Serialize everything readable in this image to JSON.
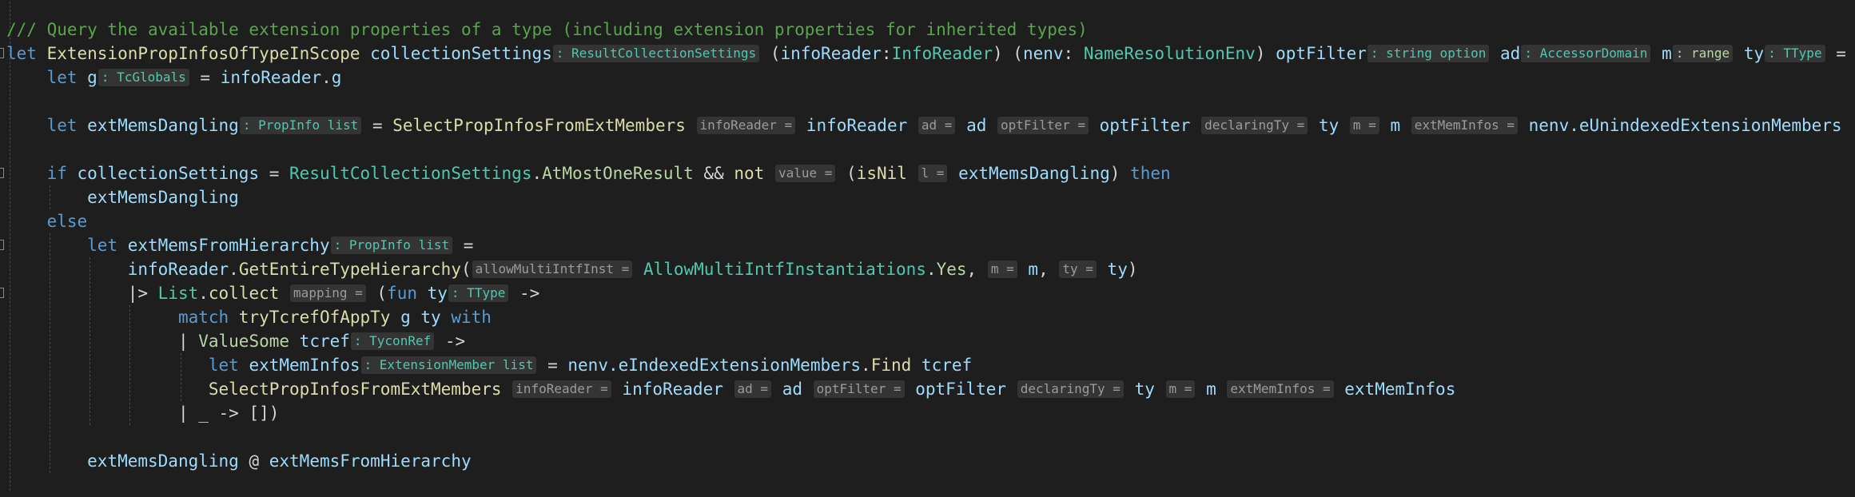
{
  "colors": {
    "background": "#1e1e1e",
    "keyword": "#569cd6",
    "function": "#dcdcaa",
    "variable": "#9cdcfe",
    "type": "#4ec9b0",
    "comment": "#57a64a",
    "union_case": "#b8d7a3",
    "hint_background": "#343434"
  },
  "code": {
    "lines": [
      {
        "tokens": []
      },
      {
        "tokens": [
          [
            "/// Query the available extension properties of a type (including extension properties for inherited types)",
            "com"
          ]
        ]
      },
      {
        "fold": true,
        "tokens": [
          [
            "let ",
            "kw"
          ],
          [
            "ExtensionPropInfosOfTypeInScope ",
            "fn"
          ],
          [
            "collectionSettings",
            "var"
          ],
          [
            ": ResultCollectionSettings",
            "ht"
          ],
          [
            " (",
            "p"
          ],
          [
            "infoReader",
            "var"
          ],
          [
            ":",
            "p"
          ],
          [
            "InfoReader",
            "type"
          ],
          [
            ") (",
            "p"
          ],
          [
            "nenv",
            "var"
          ],
          [
            ": ",
            "p"
          ],
          [
            "NameResolutionEnv",
            "type"
          ],
          [
            ") ",
            "p"
          ],
          [
            "optFilter",
            "var"
          ],
          [
            ": string option",
            "ht"
          ],
          [
            " ",
            "p"
          ],
          [
            "ad",
            "var"
          ],
          [
            ": AccessorDomain",
            "ht"
          ],
          [
            " ",
            "p"
          ],
          [
            "m",
            "var"
          ],
          [
            ": range",
            "hu"
          ],
          [
            " ",
            "p"
          ],
          [
            "ty",
            "var"
          ],
          [
            ": TType",
            "ht"
          ],
          [
            " =",
            "op"
          ]
        ]
      },
      {
        "tokens": [
          [
            "    ",
            "p"
          ],
          [
            "let ",
            "kw"
          ],
          [
            "g",
            "var"
          ],
          [
            ": TcGlobals",
            "ht"
          ],
          [
            " = ",
            "op"
          ],
          [
            "infoReader",
            "var"
          ],
          [
            ".g",
            "var"
          ]
        ]
      },
      {
        "tokens": []
      },
      {
        "tokens": [
          [
            "    ",
            "p"
          ],
          [
            "let ",
            "kw"
          ],
          [
            "extMemsDangling",
            "var"
          ],
          [
            ": PropInfo list",
            "ht"
          ],
          [
            " = ",
            "op"
          ],
          [
            "SelectPropInfosFromExtMembers ",
            "fn"
          ],
          [
            "infoReader =",
            "hp"
          ],
          [
            " ",
            "p"
          ],
          [
            "infoReader ",
            "var"
          ],
          [
            "ad =",
            "hp"
          ],
          [
            " ",
            "p"
          ],
          [
            "ad ",
            "var"
          ],
          [
            "optFilter =",
            "hp"
          ],
          [
            " ",
            "p"
          ],
          [
            "optFilter ",
            "var"
          ],
          [
            "declaringTy =",
            "hp"
          ],
          [
            " ",
            "p"
          ],
          [
            "ty ",
            "var"
          ],
          [
            "m =",
            "hp"
          ],
          [
            " ",
            "p"
          ],
          [
            "m ",
            "var"
          ],
          [
            "extMemInfos =",
            "hp"
          ],
          [
            " ",
            "p"
          ],
          [
            "nenv.eUnindexedExtensionMembers",
            "var"
          ]
        ]
      },
      {
        "tokens": []
      },
      {
        "fold": true,
        "tokens": [
          [
            "    ",
            "p"
          ],
          [
            "if ",
            "kw"
          ],
          [
            "collectionSettings ",
            "var"
          ],
          [
            "= ",
            "op"
          ],
          [
            "ResultCollectionSettings",
            "type"
          ],
          [
            ".",
            "op"
          ],
          [
            "AtMostOneResult ",
            "uc"
          ],
          [
            "&& ",
            "op"
          ],
          [
            "not ",
            "fn"
          ],
          [
            "value =",
            "hp"
          ],
          [
            " (",
            "p"
          ],
          [
            "isNil ",
            "fn"
          ],
          [
            "l =",
            "hp"
          ],
          [
            " ",
            "p"
          ],
          [
            "extMemsDangling",
            "var"
          ],
          [
            ") ",
            "p"
          ],
          [
            "then",
            "kw"
          ]
        ]
      },
      {
        "tokens": [
          [
            "        ",
            "p"
          ],
          [
            "extMemsDangling",
            "var"
          ]
        ]
      },
      {
        "tokens": [
          [
            "    ",
            "p"
          ],
          [
            "else",
            "kw"
          ]
        ]
      },
      {
        "fold": true,
        "tokens": [
          [
            "        ",
            "p"
          ],
          [
            "let ",
            "kw"
          ],
          [
            "extMemsFromHierarchy",
            "var"
          ],
          [
            ": PropInfo list",
            "ht"
          ],
          [
            " =",
            "op"
          ]
        ]
      },
      {
        "tokens": [
          [
            "            ",
            "p"
          ],
          [
            "infoReader",
            "var"
          ],
          [
            ".",
            "op"
          ],
          [
            "GetEntireTypeHierarchy",
            "fn"
          ],
          [
            "(",
            "p"
          ],
          [
            "allowMultiIntfInst =",
            "hp"
          ],
          [
            " ",
            "p"
          ],
          [
            "AllowMultiIntfInstantiations",
            "type"
          ],
          [
            ".",
            "op"
          ],
          [
            "Yes",
            "uc"
          ],
          [
            ", ",
            "p"
          ],
          [
            "m =",
            "hp"
          ],
          [
            " ",
            "p"
          ],
          [
            "m",
            "var"
          ],
          [
            ", ",
            "p"
          ],
          [
            "ty =",
            "hp"
          ],
          [
            " ",
            "p"
          ],
          [
            "ty",
            "var"
          ],
          [
            ")",
            "p"
          ]
        ]
      },
      {
        "fold": true,
        "tokens": [
          [
            "            ",
            "p"
          ],
          [
            "|> ",
            "op"
          ],
          [
            "List",
            "type"
          ],
          [
            ".",
            "op"
          ],
          [
            "collect ",
            "fn"
          ],
          [
            "mapping =",
            "hp"
          ],
          [
            " (",
            "p"
          ],
          [
            "fun ",
            "kw"
          ],
          [
            "ty",
            "var"
          ],
          [
            ": TType",
            "ht"
          ],
          [
            " ->",
            "op"
          ]
        ]
      },
      {
        "tokens": [
          [
            "                 ",
            "p"
          ],
          [
            "match ",
            "kw"
          ],
          [
            "tryTcrefOfAppTy ",
            "fn"
          ],
          [
            "g ",
            "var"
          ],
          [
            "ty ",
            "var"
          ],
          [
            "with",
            "kw"
          ]
        ]
      },
      {
        "tokens": [
          [
            "                 ",
            "p"
          ],
          [
            "| ",
            "op"
          ],
          [
            "ValueSome ",
            "uc"
          ],
          [
            "tcref",
            "var"
          ],
          [
            ": TyconRef",
            "ht"
          ],
          [
            " ->",
            "op"
          ]
        ]
      },
      {
        "tokens": [
          [
            "                    ",
            "p"
          ],
          [
            "let ",
            "kw"
          ],
          [
            "extMemInfos",
            "var"
          ],
          [
            ": ExtensionMember list",
            "ht"
          ],
          [
            " = ",
            "op"
          ],
          [
            "nenv.eIndexedExtensionMembers",
            "var"
          ],
          [
            ".",
            "op"
          ],
          [
            "Find ",
            "fn"
          ],
          [
            "tcref",
            "var"
          ]
        ]
      },
      {
        "tokens": [
          [
            "                    ",
            "p"
          ],
          [
            "SelectPropInfosFromExtMembers ",
            "fn"
          ],
          [
            "infoReader =",
            "hp"
          ],
          [
            " ",
            "p"
          ],
          [
            "infoReader ",
            "var"
          ],
          [
            "ad =",
            "hp"
          ],
          [
            " ",
            "p"
          ],
          [
            "ad ",
            "var"
          ],
          [
            "optFilter =",
            "hp"
          ],
          [
            " ",
            "p"
          ],
          [
            "optFilter ",
            "var"
          ],
          [
            "declaringTy =",
            "hp"
          ],
          [
            " ",
            "p"
          ],
          [
            "ty ",
            "var"
          ],
          [
            "m =",
            "hp"
          ],
          [
            " ",
            "p"
          ],
          [
            "m ",
            "var"
          ],
          [
            "extMemInfos =",
            "hp"
          ],
          [
            " ",
            "p"
          ],
          [
            "extMemInfos",
            "var"
          ]
        ]
      },
      {
        "tokens": [
          [
            "                 ",
            "p"
          ],
          [
            "| ",
            "op"
          ],
          [
            "_ ",
            "p"
          ],
          [
            "-> ",
            "op"
          ],
          [
            "[])",
            "p"
          ]
        ]
      },
      {
        "tokens": []
      },
      {
        "tokens": [
          [
            "        ",
            "p"
          ],
          [
            "extMemsDangling ",
            "var"
          ],
          [
            "@ ",
            "op"
          ],
          [
            "extMemsFromHierarchy",
            "var"
          ]
        ]
      },
      {
        "tokens": []
      }
    ]
  }
}
